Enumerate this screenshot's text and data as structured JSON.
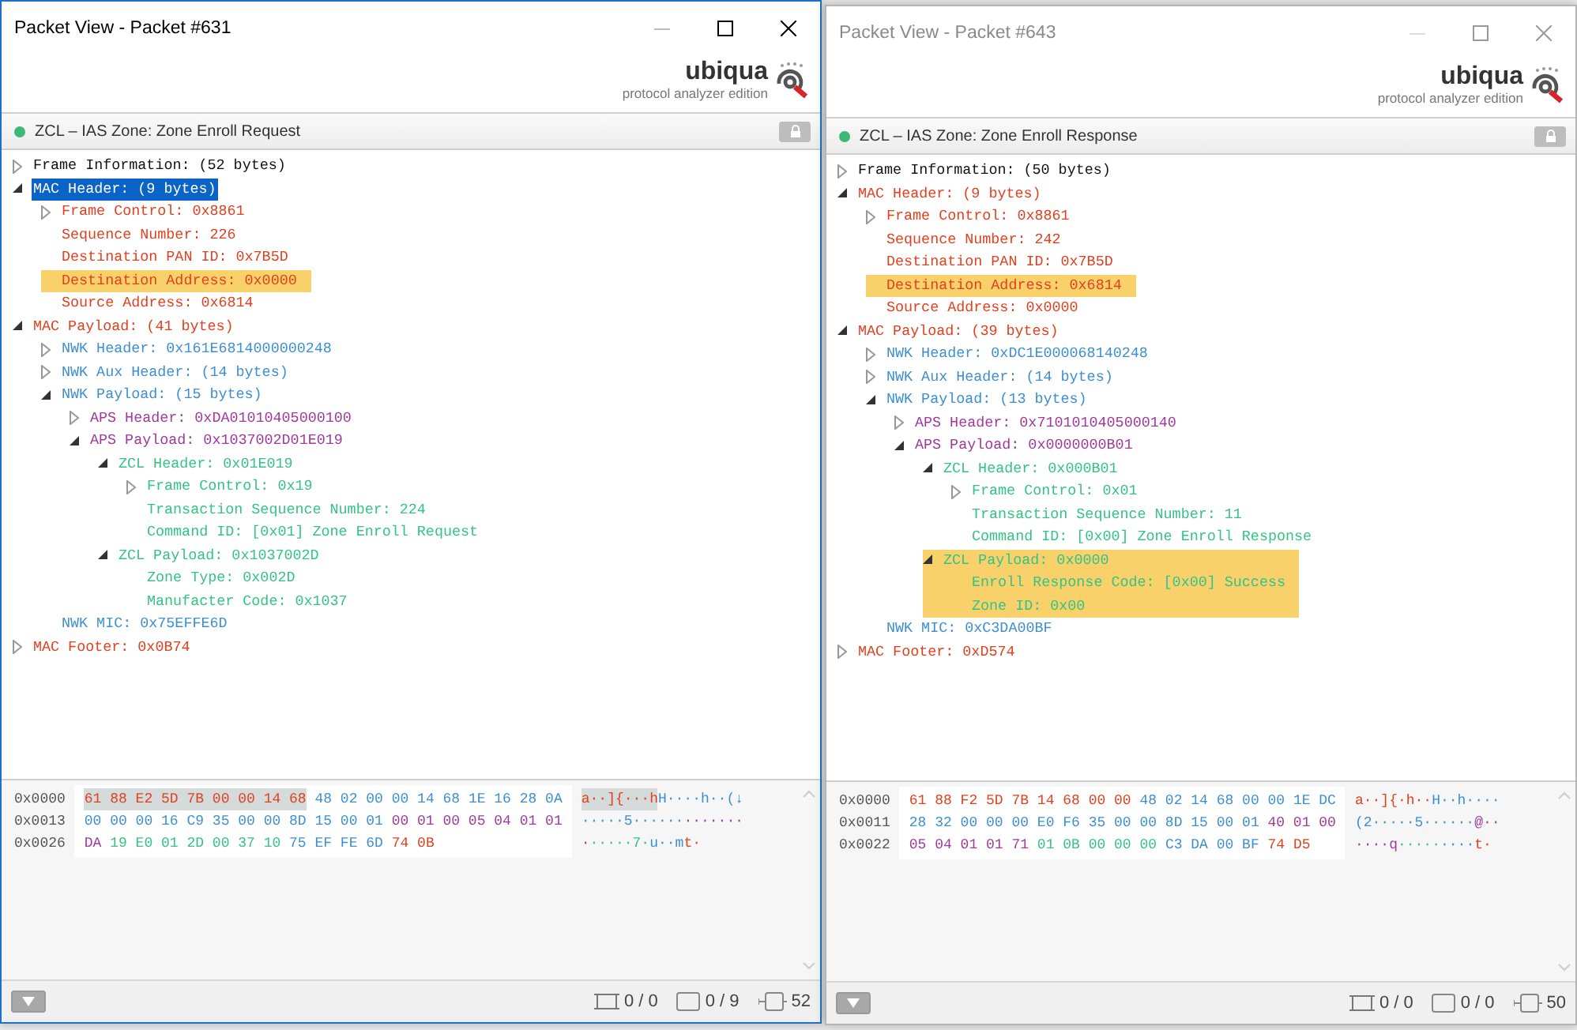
{
  "windows": [
    {
      "title": "Packet View - Packet #631",
      "active": true,
      "logo": {
        "name": "ubiqua",
        "edition": "protocol analyzer edition"
      },
      "summary": {
        "text": "ZCL – IAS Zone: Zone Enroll Request",
        "color": "#3cb878"
      },
      "tree": [
        {
          "text": "Frame Information: (52 bytes)",
          "kind": "frame",
          "expanded": false,
          "selected": false,
          "highlighted": false
        },
        {
          "text": "MAC Header: (9 bytes)",
          "kind": "mac",
          "expanded": true,
          "selected": true,
          "highlighted": false,
          "children": [
            {
              "text": "Frame Control: 0x8861",
              "kind": "mac",
              "expanded": false,
              "selected": false,
              "highlighted": false
            },
            {
              "text": "Sequence Number: 226",
              "kind": "mac",
              "selected": false,
              "highlighted": false
            },
            {
              "text": "Destination PAN ID: 0x7B5D",
              "kind": "mac",
              "selected": false,
              "highlighted": false
            },
            {
              "text": "Destination Address: 0x0000",
              "kind": "mac",
              "selected": false,
              "highlighted": true
            },
            {
              "text": "Source Address: 0x6814",
              "kind": "mac",
              "selected": false,
              "highlighted": false
            }
          ]
        },
        {
          "text": "MAC Payload: (41 bytes)",
          "kind": "mac",
          "expanded": true,
          "selected": false,
          "highlighted": false,
          "children": [
            {
              "text": "NWK Header: 0x161E6814000000248",
              "kind": "nwk",
              "expanded": false,
              "selected": false,
              "highlighted": false
            },
            {
              "text": "NWK Aux Header: (14 bytes)",
              "kind": "nwk",
              "expanded": false,
              "selected": false,
              "highlighted": false
            },
            {
              "text": "NWK Payload: (15 bytes)",
              "kind": "nwk",
              "expanded": true,
              "selected": false,
              "highlighted": false,
              "children": [
                {
                  "text": "APS Header: 0xDA01010405000100",
                  "kind": "aps",
                  "expanded": false,
                  "selected": false,
                  "highlighted": false
                },
                {
                  "text": "APS Payload: 0x1037002D01E019",
                  "kind": "aps",
                  "expanded": true,
                  "selected": false,
                  "highlighted": false,
                  "children": [
                    {
                      "text": "ZCL Header: 0x01E019",
                      "kind": "zcl",
                      "expanded": true,
                      "selected": false,
                      "highlighted": false,
                      "children": [
                        {
                          "text": "Frame Control: 0x19",
                          "kind": "zcl",
                          "expanded": false,
                          "selected": false,
                          "highlighted": false
                        },
                        {
                          "text": "Transaction Sequence Number: 224",
                          "kind": "zcl",
                          "selected": false,
                          "highlighted": false
                        },
                        {
                          "text": "Command ID: [0x01] Zone Enroll Request",
                          "kind": "zcl",
                          "selected": false,
                          "highlighted": false
                        }
                      ]
                    },
                    {
                      "text": "ZCL Payload: 0x1037002D",
                      "kind": "zcl",
                      "expanded": true,
                      "selected": false,
                      "highlighted": false,
                      "children": [
                        {
                          "text": "Zone Type: 0x002D",
                          "kind": "zcl",
                          "selected": false,
                          "highlighted": false
                        },
                        {
                          "text": "Manufacter Code: 0x1037",
                          "kind": "zcl",
                          "selected": false,
                          "highlighted": false
                        }
                      ]
                    }
                  ]
                }
              ]
            },
            {
              "text": "NWK MIC: 0x75EFFE6D",
              "kind": "nwk",
              "selected": false,
              "highlighted": false
            }
          ]
        },
        {
          "text": "MAC Footer: 0x0B74",
          "kind": "mac",
          "expanded": false,
          "selected": false,
          "highlighted": false
        }
      ],
      "hex": [
        {
          "offset": "0x0000",
          "bytes": [
            {
              "kind": "mac",
              "text": "61 88 E2 5D 7B 00 00 14 68",
              "selected": true
            },
            {
              "kind": "nwk",
              "text": "48 02 00 00 14 68 1E 16 28 0A",
              "selected": false
            }
          ],
          "ascii": [
            {
              "kind": "mac",
              "text": "a··]{···h",
              "selected": true
            },
            {
              "kind": "nwk",
              "text": "H····h··(↓",
              "selected": false
            }
          ]
        },
        {
          "offset": "0x0013",
          "bytes": [
            {
              "kind": "nwk",
              "text": "00 00 00 16 C9 35 00 00 8D 15 00 01",
              "selected": false
            },
            {
              "kind": "aps",
              "text": "00 01 00 05 04 01 01",
              "selected": false
            }
          ],
          "ascii": [
            {
              "kind": "nwk",
              "text": "·····5······",
              "selected": false
            },
            {
              "kind": "aps",
              "text": "·······",
              "selected": false
            }
          ]
        },
        {
          "offset": "0x0026",
          "bytes": [
            {
              "kind": "aps",
              "text": "DA",
              "selected": false
            },
            {
              "kind": "zcl",
              "text": "19 E0 01 2D 00 37 10",
              "selected": false
            },
            {
              "kind": "nwk",
              "text": "75 EF FE 6D",
              "selected": false
            },
            {
              "kind": "mac",
              "text": "74 0B",
              "selected": false
            }
          ],
          "ascii": [
            {
              "kind": "aps",
              "text": "·",
              "selected": false
            },
            {
              "kind": "zcl",
              "text": "·····7·",
              "selected": false
            },
            {
              "kind": "nwk",
              "text": "u··m",
              "selected": false
            },
            {
              "kind": "mac",
              "text": "t·",
              "selected": false
            }
          ]
        }
      ],
      "status": [
        {
          "kind": "selection",
          "text": "0 / 0"
        },
        {
          "kind": "range",
          "text": "0 / 9"
        },
        {
          "kind": "length",
          "text": "52"
        }
      ]
    },
    {
      "title": "Packet View - Packet #643",
      "active": false,
      "logo": {
        "name": "ubiqua",
        "edition": "protocol analyzer edition"
      },
      "summary": {
        "text": "ZCL – IAS Zone: Zone Enroll Response",
        "color": "#3cb878"
      },
      "tree": [
        {
          "text": "Frame Information: (50 bytes)",
          "kind": "frame",
          "expanded": false,
          "selected": false,
          "highlighted": false
        },
        {
          "text": "MAC Header: (9 bytes)",
          "kind": "mac",
          "expanded": true,
          "selected": false,
          "highlighted": false,
          "children": [
            {
              "text": "Frame Control: 0x8861",
              "kind": "mac",
              "expanded": false,
              "selected": false,
              "highlighted": false
            },
            {
              "text": "Sequence Number: 242",
              "kind": "mac",
              "selected": false,
              "highlighted": false
            },
            {
              "text": "Destination PAN ID: 0x7B5D",
              "kind": "mac",
              "selected": false,
              "highlighted": false
            },
            {
              "text": "Destination Address: 0x6814",
              "kind": "mac",
              "selected": false,
              "highlighted": true
            },
            {
              "text": "Source Address: 0x0000",
              "kind": "mac",
              "selected": false,
              "highlighted": false
            }
          ]
        },
        {
          "text": "MAC Payload: (39 bytes)",
          "kind": "mac",
          "expanded": true,
          "selected": false,
          "highlighted": false,
          "children": [
            {
              "text": "NWK Header: 0xDC1E000068140248",
              "kind": "nwk",
              "expanded": false,
              "selected": false,
              "highlighted": false
            },
            {
              "text": "NWK Aux Header: (14 bytes)",
              "kind": "nwk",
              "expanded": false,
              "selected": false,
              "highlighted": false
            },
            {
              "text": "NWK Payload: (13 bytes)",
              "kind": "nwk",
              "expanded": true,
              "selected": false,
              "highlighted": false,
              "children": [
                {
                  "text": "APS Header: 0x7101010405000140",
                  "kind": "aps",
                  "expanded": false,
                  "selected": false,
                  "highlighted": false
                },
                {
                  "text": "APS Payload: 0x0000000B01",
                  "kind": "aps",
                  "expanded": true,
                  "selected": false,
                  "highlighted": false,
                  "children": [
                    {
                      "text": "ZCL Header: 0x000B01",
                      "kind": "zcl",
                      "expanded": true,
                      "selected": false,
                      "highlighted": false,
                      "children": [
                        {
                          "text": "Frame Control: 0x01",
                          "kind": "zcl",
                          "expanded": false,
                          "selected": false,
                          "highlighted": false
                        },
                        {
                          "text": "Transaction Sequence Number: 11",
                          "kind": "zcl",
                          "selected": false,
                          "highlighted": false
                        },
                        {
                          "text": "Command ID: [0x00] Zone Enroll Response",
                          "kind": "zcl",
                          "selected": false,
                          "highlighted": false
                        }
                      ]
                    },
                    {
                      "text": "ZCL Payload: 0x0000",
                      "kind": "zcl",
                      "expanded": true,
                      "selected": false,
                      "highlighted": true,
                      "children": [
                        {
                          "text": "Enroll Response Code: [0x00] Success",
                          "kind": "zcl",
                          "selected": false,
                          "highlighted": false
                        },
                        {
                          "text": "Zone ID: 0x00",
                          "kind": "zcl",
                          "selected": false,
                          "highlighted": false
                        }
                      ]
                    }
                  ]
                }
              ]
            },
            {
              "text": "NWK MIC: 0xC3DA00BF",
              "kind": "nwk",
              "selected": false,
              "highlighted": false
            }
          ]
        },
        {
          "text": "MAC Footer: 0xD574",
          "kind": "mac",
          "expanded": false,
          "selected": false,
          "highlighted": false
        }
      ],
      "hex": [
        {
          "offset": "0x0000",
          "bytes": [
            {
              "kind": "mac",
              "text": "61 88 F2 5D 7B 14 68 00 00",
              "selected": false
            },
            {
              "kind": "nwk",
              "text": "48 02 14 68 00 00 1E DC",
              "selected": false
            }
          ],
          "ascii": [
            {
              "kind": "mac",
              "text": "a··]{·h··",
              "selected": false
            },
            {
              "kind": "nwk",
              "text": "H··h····",
              "selected": false
            }
          ]
        },
        {
          "offset": "0x0011",
          "bytes": [
            {
              "kind": "nwk",
              "text": "28 32 00 00 00 E0 F6 35 00 00 8D 15 00 01",
              "selected": false
            },
            {
              "kind": "aps",
              "text": "40 01 00",
              "selected": false
            }
          ],
          "ascii": [
            {
              "kind": "nwk",
              "text": "(2·····5······",
              "selected": false
            },
            {
              "kind": "aps",
              "text": "@··",
              "selected": false
            }
          ]
        },
        {
          "offset": "0x0022",
          "bytes": [
            {
              "kind": "aps",
              "text": "05 04 01 01 71",
              "selected": false
            },
            {
              "kind": "zcl",
              "text": "01 0B 00 00 00",
              "selected": false
            },
            {
              "kind": "nwk",
              "text": "C3 DA 00 BF",
              "selected": false
            },
            {
              "kind": "mac",
              "text": "74 D5",
              "selected": false
            }
          ],
          "ascii": [
            {
              "kind": "aps",
              "text": "····q",
              "selected": false
            },
            {
              "kind": "zcl",
              "text": "·····",
              "selected": false
            },
            {
              "kind": "nwk",
              "text": "····",
              "selected": false
            },
            {
              "kind": "mac",
              "text": "t·",
              "selected": false
            }
          ]
        }
      ],
      "status": [
        {
          "kind": "selection",
          "text": "0 / 0"
        },
        {
          "kind": "range",
          "text": "0 / 0"
        },
        {
          "kind": "length",
          "text": "50"
        }
      ]
    }
  ]
}
